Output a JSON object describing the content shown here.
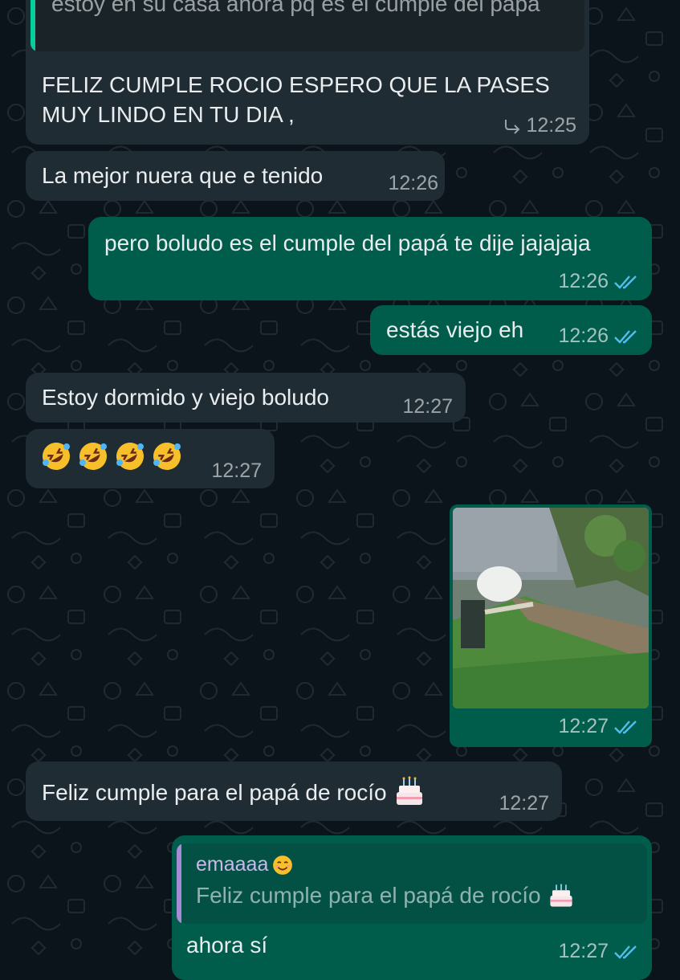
{
  "messages": {
    "m1": {
      "quoted_text": "estoy en su casa ahora pq es el cumple del papá",
      "text": "FELIZ CUMPLE ROCIO ESPERO QUE LA PASES MUY LINDO EN TU DIA ,",
      "time": "12:25",
      "forward_icon": "reply-arrow-icon"
    },
    "m2": {
      "text": "La mejor nuera que e tenido",
      "time": "12:26"
    },
    "m3": {
      "text": "pero boludo es el cumple del papá te dije jajajaja",
      "time": "12:26",
      "status": "read"
    },
    "m4": {
      "text": "estás viejo eh",
      "time": "12:26",
      "status": "read"
    },
    "m5": {
      "text": "Estoy dormido y viejo boludo",
      "time": "12:27"
    },
    "m6": {
      "emoji": [
        "rolling-on-floor-laughing",
        "rolling-on-floor-laughing",
        "rolling-on-floor-laughing",
        "rolling-on-floor-laughing"
      ],
      "time": "12:27"
    },
    "m7": {
      "media": "photo",
      "time": "12:27",
      "status": "read"
    },
    "m8": {
      "text": "Feliz cumple para el papá de rocío",
      "emoji": "birthday-cake",
      "time": "12:27"
    },
    "m9": {
      "quoted_author": "emaaaa",
      "quoted_author_emoji": "smiling-face",
      "quoted_text": "Feliz cumple para el papá de rocío",
      "quoted_emoji": "birthday-cake",
      "text": "ahora sí",
      "time": "12:27",
      "status": "read"
    }
  },
  "colors": {
    "background": "#0b141a",
    "incoming_bubble": "#202c33",
    "outgoing_bubble": "#005c4b",
    "read_ticks": "#53bdeb",
    "quote_bar_incoming": "#06cf9c",
    "quote_bar_outgoing": "#a78bd4"
  }
}
